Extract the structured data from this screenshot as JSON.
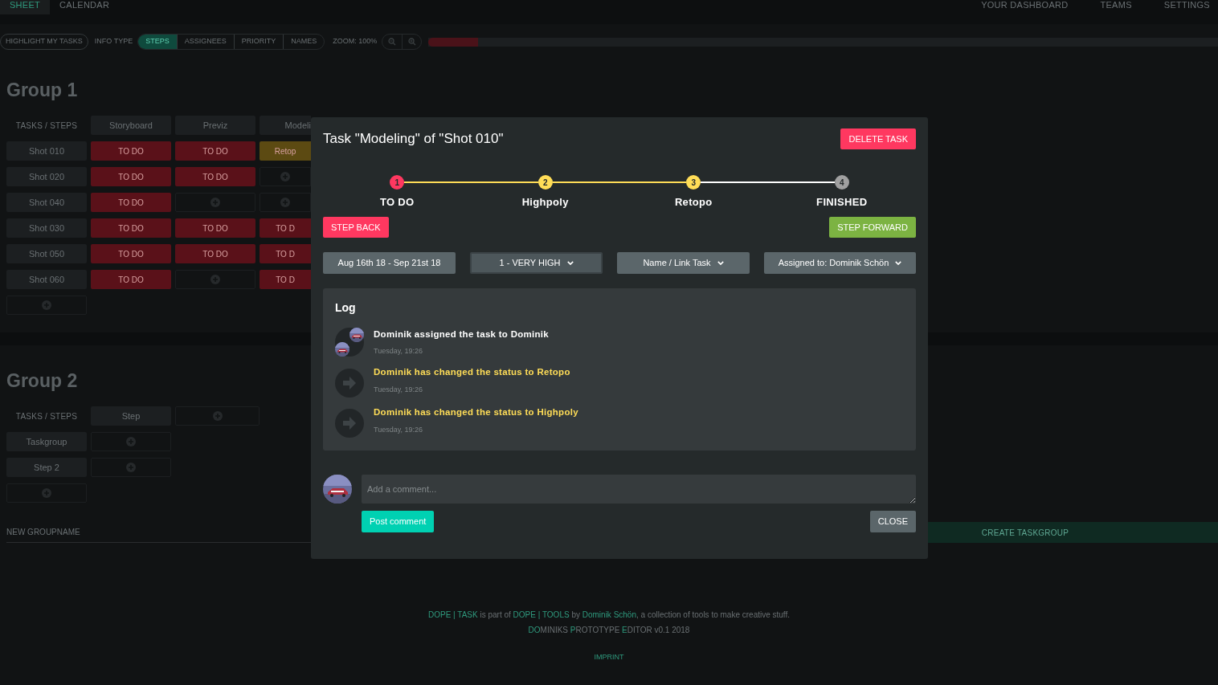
{
  "nav": {
    "left": [
      {
        "label": "SHEET",
        "selected": true
      },
      {
        "label": "CALENDAR",
        "selected": false
      }
    ],
    "right": [
      "YOUR DASHBOARD",
      "TEAMS",
      "SETTINGS"
    ]
  },
  "toolbar": {
    "highlight": "HIGHLIGHT MY TASKS",
    "info_type_label": "INFO TYPE",
    "info_types": [
      {
        "label": "STEPS",
        "selected": true
      },
      {
        "label": "ASSIGNEES",
        "selected": false
      },
      {
        "label": "PRIORITY",
        "selected": false
      },
      {
        "label": "NAMES",
        "selected": false
      }
    ],
    "zoom": "ZOOM: 100%",
    "progress": {
      "level": 0.063
    }
  },
  "groups": [
    {
      "title": "Group 1",
      "header": "TASKS / STEPS",
      "steps": [
        {
          "kind": "step",
          "label": "Storyboard"
        },
        {
          "kind": "step",
          "label": "Previz"
        },
        {
          "kind": "partial",
          "label": "Modeli"
        }
      ],
      "rows": [
        {
          "name": "Shot 010",
          "cells": [
            {
              "kind": "task",
              "label": "TO DO",
              "color": "#5a1119"
            },
            {
              "kind": "task",
              "label": "TO DO",
              "color": "#5a1119"
            },
            {
              "kind": "task",
              "label": "Retop",
              "color": "#5c4a12"
            }
          ]
        },
        {
          "name": "Shot 020",
          "cells": [
            {
              "kind": "task",
              "label": "TO DO",
              "color": "#5a1119"
            },
            {
              "kind": "task",
              "label": "TO DO",
              "color": "#5a1119"
            },
            {
              "kind": "add"
            }
          ]
        },
        {
          "name": "Shot 040",
          "cells": [
            {
              "kind": "task",
              "label": "TO DO",
              "color": "#5a1119"
            },
            {
              "kind": "add"
            },
            {
              "kind": "add"
            }
          ]
        },
        {
          "name": "Shot 030",
          "cells": [
            {
              "kind": "task",
              "label": "TO DO",
              "color": "#5a1119"
            },
            {
              "kind": "task",
              "label": "TO DO",
              "color": "#5a1119"
            },
            {
              "kind": "task",
              "label": "TO D",
              "color": "#5a1119"
            }
          ]
        },
        {
          "name": "Shot 050",
          "cells": [
            {
              "kind": "task",
              "label": "TO DO",
              "color": "#5a1119"
            },
            {
              "kind": "task",
              "label": "TO DO",
              "color": "#5a1119"
            },
            {
              "kind": "task",
              "label": "TO D",
              "color": "#5a1119"
            }
          ]
        },
        {
          "name": "Shot 060",
          "cells": [
            {
              "kind": "task",
              "label": "TO DO",
              "color": "#5a1119"
            },
            {
              "kind": "add"
            },
            {
              "kind": "task",
              "label": "TO D",
              "color": "#5a1119"
            }
          ]
        }
      ],
      "add_row_button": true
    },
    {
      "title": "Group 2",
      "header": "TASKS / STEPS",
      "steps": [
        {
          "kind": "step",
          "label": "Step"
        },
        {
          "kind": "add"
        }
      ],
      "rows": [
        {
          "name": "Taskgroup",
          "cells": [
            {
              "kind": "add"
            }
          ]
        },
        {
          "name": "Step 2",
          "cells": [
            {
              "kind": "add"
            }
          ]
        }
      ],
      "add_row_button": true
    }
  ],
  "new_group": {
    "placeholder": "NEW GROUPNAME",
    "create_button": "CREATE TASKGROUP"
  },
  "footer": {
    "line1": [
      {
        "text": "DOPE | TASK",
        "highlight": true
      },
      {
        "text": " is part of ",
        "highlight": false
      },
      {
        "text": "DOPE | TOOLS",
        "highlight": true
      },
      {
        "text": " by ",
        "highlight": false
      },
      {
        "text": "Dominik Schön",
        "highlight": true
      },
      {
        "text": ", a collection of tools to make creative stuff.",
        "highlight": false
      }
    ],
    "line2": [
      {
        "text": "DO",
        "highlight": true
      },
      {
        "text": "MINIKS ",
        "highlight": false
      },
      {
        "text": "P",
        "highlight": true
      },
      {
        "text": "ROTOTYPE ",
        "highlight": false
      },
      {
        "text": "E",
        "highlight": true
      },
      {
        "text": "DITOR v0.1 2018",
        "highlight": false
      }
    ],
    "imprint": "IMPRINT"
  },
  "modal": {
    "title": "Task \"Modeling\" of \"Shot 010\"",
    "delete_button": "DELETE TASK",
    "steps": [
      {
        "number": "1",
        "label": "TO DO",
        "color": "#ff3860"
      },
      {
        "number": "2",
        "label": "Highpoly",
        "color": "#ffdd57"
      },
      {
        "number": "3",
        "label": "Retopo",
        "color": "#ffdd57"
      },
      {
        "number": "4",
        "label": "FINISHED",
        "color": "#a0a0a0"
      }
    ],
    "connectors": [
      {
        "color": "#ffdd57"
      },
      {
        "color": "#ffdd57"
      },
      {
        "color": "#ffffff"
      }
    ],
    "step_back": "STEP BACK",
    "step_forward": "STEP FORWARD",
    "dropdowns": [
      {
        "label": "Aug 16th 18 - Sep 21st 18",
        "caret": false,
        "focused": false
      },
      {
        "label": "1 - VERY HIGH",
        "caret": true,
        "focused": true
      },
      {
        "label": "Name / Link Task",
        "caret": true,
        "focused": false
      },
      {
        "label": "Assigned to: Dominik Schön",
        "caret": true,
        "focused": false
      }
    ],
    "log": {
      "title": "Log",
      "entries": [
        {
          "kind": "assign",
          "text": "Dominik assigned the task to Dominik",
          "time": "Tuesday, 19:26"
        },
        {
          "kind": "status",
          "text": "Dominik has changed the status to Retopo",
          "time": "Tuesday, 19:26"
        },
        {
          "kind": "status",
          "text": "Dominik has changed the status to Highpoly",
          "time": "Tuesday, 19:26"
        }
      ]
    },
    "comment": {
      "placeholder": "Add a comment..."
    },
    "post_button": "Post comment",
    "close_button": "CLOSE"
  }
}
